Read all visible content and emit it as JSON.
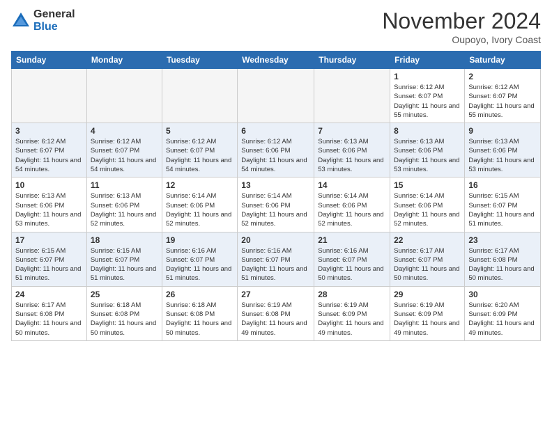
{
  "logo": {
    "general": "General",
    "blue": "Blue"
  },
  "header": {
    "month": "November 2024",
    "location": "Oupoyo, Ivory Coast"
  },
  "weekdays": [
    "Sunday",
    "Monday",
    "Tuesday",
    "Wednesday",
    "Thursday",
    "Friday",
    "Saturday"
  ],
  "weeks": [
    [
      {
        "day": "",
        "info": ""
      },
      {
        "day": "",
        "info": ""
      },
      {
        "day": "",
        "info": ""
      },
      {
        "day": "",
        "info": ""
      },
      {
        "day": "",
        "info": ""
      },
      {
        "day": "1",
        "info": "Sunrise: 6:12 AM\nSunset: 6:07 PM\nDaylight: 11 hours and 55 minutes."
      },
      {
        "day": "2",
        "info": "Sunrise: 6:12 AM\nSunset: 6:07 PM\nDaylight: 11 hours and 55 minutes."
      }
    ],
    [
      {
        "day": "3",
        "info": "Sunrise: 6:12 AM\nSunset: 6:07 PM\nDaylight: 11 hours and 54 minutes."
      },
      {
        "day": "4",
        "info": "Sunrise: 6:12 AM\nSunset: 6:07 PM\nDaylight: 11 hours and 54 minutes."
      },
      {
        "day": "5",
        "info": "Sunrise: 6:12 AM\nSunset: 6:07 PM\nDaylight: 11 hours and 54 minutes."
      },
      {
        "day": "6",
        "info": "Sunrise: 6:12 AM\nSunset: 6:06 PM\nDaylight: 11 hours and 54 minutes."
      },
      {
        "day": "7",
        "info": "Sunrise: 6:13 AM\nSunset: 6:06 PM\nDaylight: 11 hours and 53 minutes."
      },
      {
        "day": "8",
        "info": "Sunrise: 6:13 AM\nSunset: 6:06 PM\nDaylight: 11 hours and 53 minutes."
      },
      {
        "day": "9",
        "info": "Sunrise: 6:13 AM\nSunset: 6:06 PM\nDaylight: 11 hours and 53 minutes."
      }
    ],
    [
      {
        "day": "10",
        "info": "Sunrise: 6:13 AM\nSunset: 6:06 PM\nDaylight: 11 hours and 53 minutes."
      },
      {
        "day": "11",
        "info": "Sunrise: 6:13 AM\nSunset: 6:06 PM\nDaylight: 11 hours and 52 minutes."
      },
      {
        "day": "12",
        "info": "Sunrise: 6:14 AM\nSunset: 6:06 PM\nDaylight: 11 hours and 52 minutes."
      },
      {
        "day": "13",
        "info": "Sunrise: 6:14 AM\nSunset: 6:06 PM\nDaylight: 11 hours and 52 minutes."
      },
      {
        "day": "14",
        "info": "Sunrise: 6:14 AM\nSunset: 6:06 PM\nDaylight: 11 hours and 52 minutes."
      },
      {
        "day": "15",
        "info": "Sunrise: 6:14 AM\nSunset: 6:06 PM\nDaylight: 11 hours and 52 minutes."
      },
      {
        "day": "16",
        "info": "Sunrise: 6:15 AM\nSunset: 6:07 PM\nDaylight: 11 hours and 51 minutes."
      }
    ],
    [
      {
        "day": "17",
        "info": "Sunrise: 6:15 AM\nSunset: 6:07 PM\nDaylight: 11 hours and 51 minutes."
      },
      {
        "day": "18",
        "info": "Sunrise: 6:15 AM\nSunset: 6:07 PM\nDaylight: 11 hours and 51 minutes."
      },
      {
        "day": "19",
        "info": "Sunrise: 6:16 AM\nSunset: 6:07 PM\nDaylight: 11 hours and 51 minutes."
      },
      {
        "day": "20",
        "info": "Sunrise: 6:16 AM\nSunset: 6:07 PM\nDaylight: 11 hours and 51 minutes."
      },
      {
        "day": "21",
        "info": "Sunrise: 6:16 AM\nSunset: 6:07 PM\nDaylight: 11 hours and 50 minutes."
      },
      {
        "day": "22",
        "info": "Sunrise: 6:17 AM\nSunset: 6:07 PM\nDaylight: 11 hours and 50 minutes."
      },
      {
        "day": "23",
        "info": "Sunrise: 6:17 AM\nSunset: 6:08 PM\nDaylight: 11 hours and 50 minutes."
      }
    ],
    [
      {
        "day": "24",
        "info": "Sunrise: 6:17 AM\nSunset: 6:08 PM\nDaylight: 11 hours and 50 minutes."
      },
      {
        "day": "25",
        "info": "Sunrise: 6:18 AM\nSunset: 6:08 PM\nDaylight: 11 hours and 50 minutes."
      },
      {
        "day": "26",
        "info": "Sunrise: 6:18 AM\nSunset: 6:08 PM\nDaylight: 11 hours and 50 minutes."
      },
      {
        "day": "27",
        "info": "Sunrise: 6:19 AM\nSunset: 6:08 PM\nDaylight: 11 hours and 49 minutes."
      },
      {
        "day": "28",
        "info": "Sunrise: 6:19 AM\nSunset: 6:09 PM\nDaylight: 11 hours and 49 minutes."
      },
      {
        "day": "29",
        "info": "Sunrise: 6:19 AM\nSunset: 6:09 PM\nDaylight: 11 hours and 49 minutes."
      },
      {
        "day": "30",
        "info": "Sunrise: 6:20 AM\nSunset: 6:09 PM\nDaylight: 11 hours and 49 minutes."
      }
    ]
  ]
}
